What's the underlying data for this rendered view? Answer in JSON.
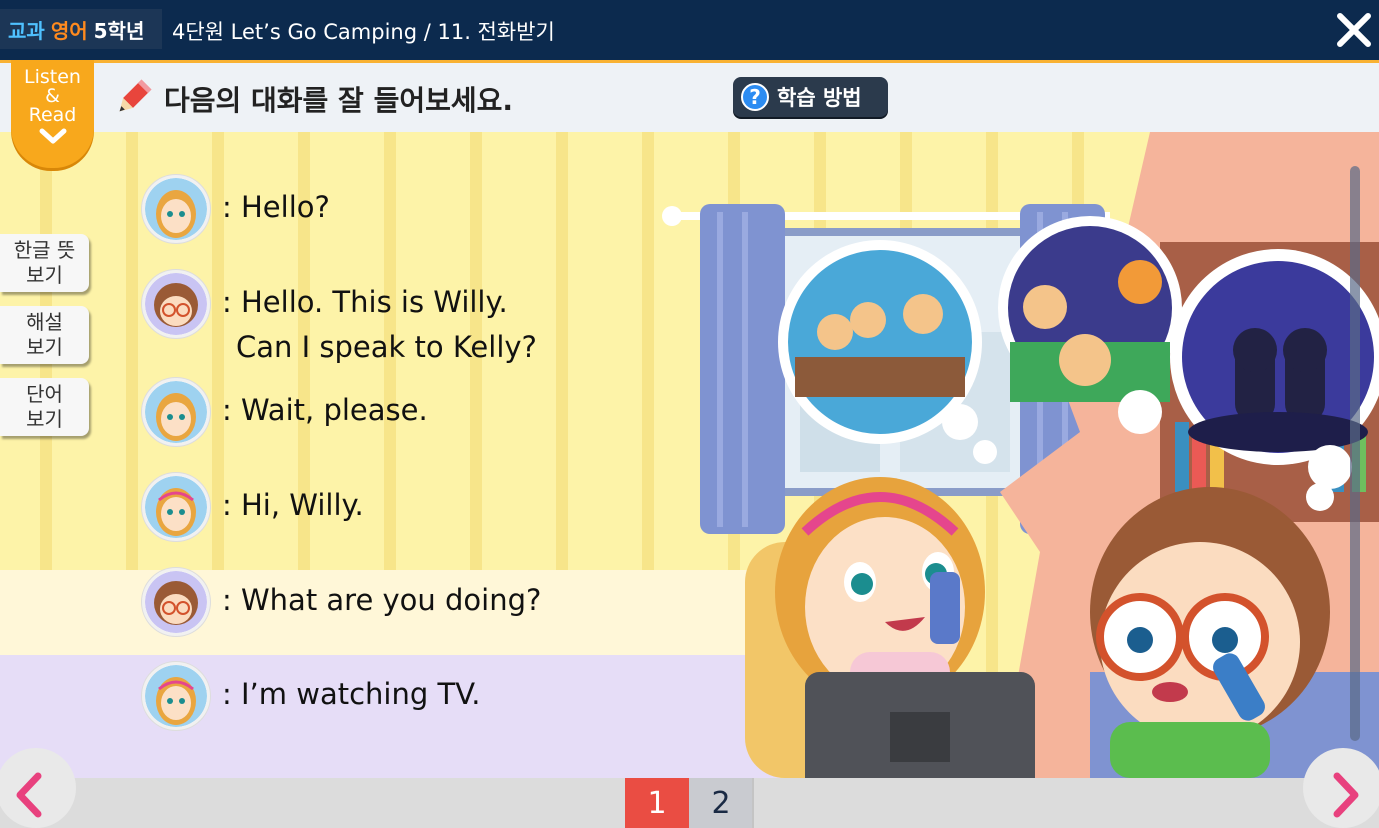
{
  "header": {
    "brand": {
      "part1": "교과",
      "part2": "영어",
      "part3": "5학년"
    },
    "breadcrumb": "4단원 Let’s Go Camping / 11. 전화받기"
  },
  "tab": {
    "line1": "Listen",
    "line2": "&",
    "line3": "Read"
  },
  "instruction": "다음의 대화를 잘 들어보세요.",
  "howto_label": "학습 방법",
  "side_buttons": [
    {
      "line1": "한글 뜻",
      "line2": "보기"
    },
    {
      "line1": "해설",
      "line2": "보기"
    },
    {
      "line1": "단어",
      "line2": "보기"
    }
  ],
  "dialogue": [
    {
      "speaker": "kelly",
      "text": ": Hello?",
      "text2": ""
    },
    {
      "speaker": "willy",
      "text": ": Hello. This is Willy.",
      "text2": "Can I speak to Kelly?"
    },
    {
      "speaker": "mom",
      "text": ": Wait, please.",
      "text2": ""
    },
    {
      "speaker": "kelly",
      "text": ": Hi, Willy.",
      "text2": ""
    },
    {
      "speaker": "willy",
      "text": ": What are you doing?",
      "text2": ""
    },
    {
      "speaker": "kelly",
      "text": ": I’m watching TV.",
      "text2": ""
    }
  ],
  "pagination": {
    "pages": [
      "1",
      "2"
    ],
    "current": "1"
  },
  "colors": {
    "titlebar": "#0c2a4e",
    "accent_orange": "#f8a81c",
    "nav_pink": "#e8417e",
    "page_active": "#ea4d43"
  }
}
